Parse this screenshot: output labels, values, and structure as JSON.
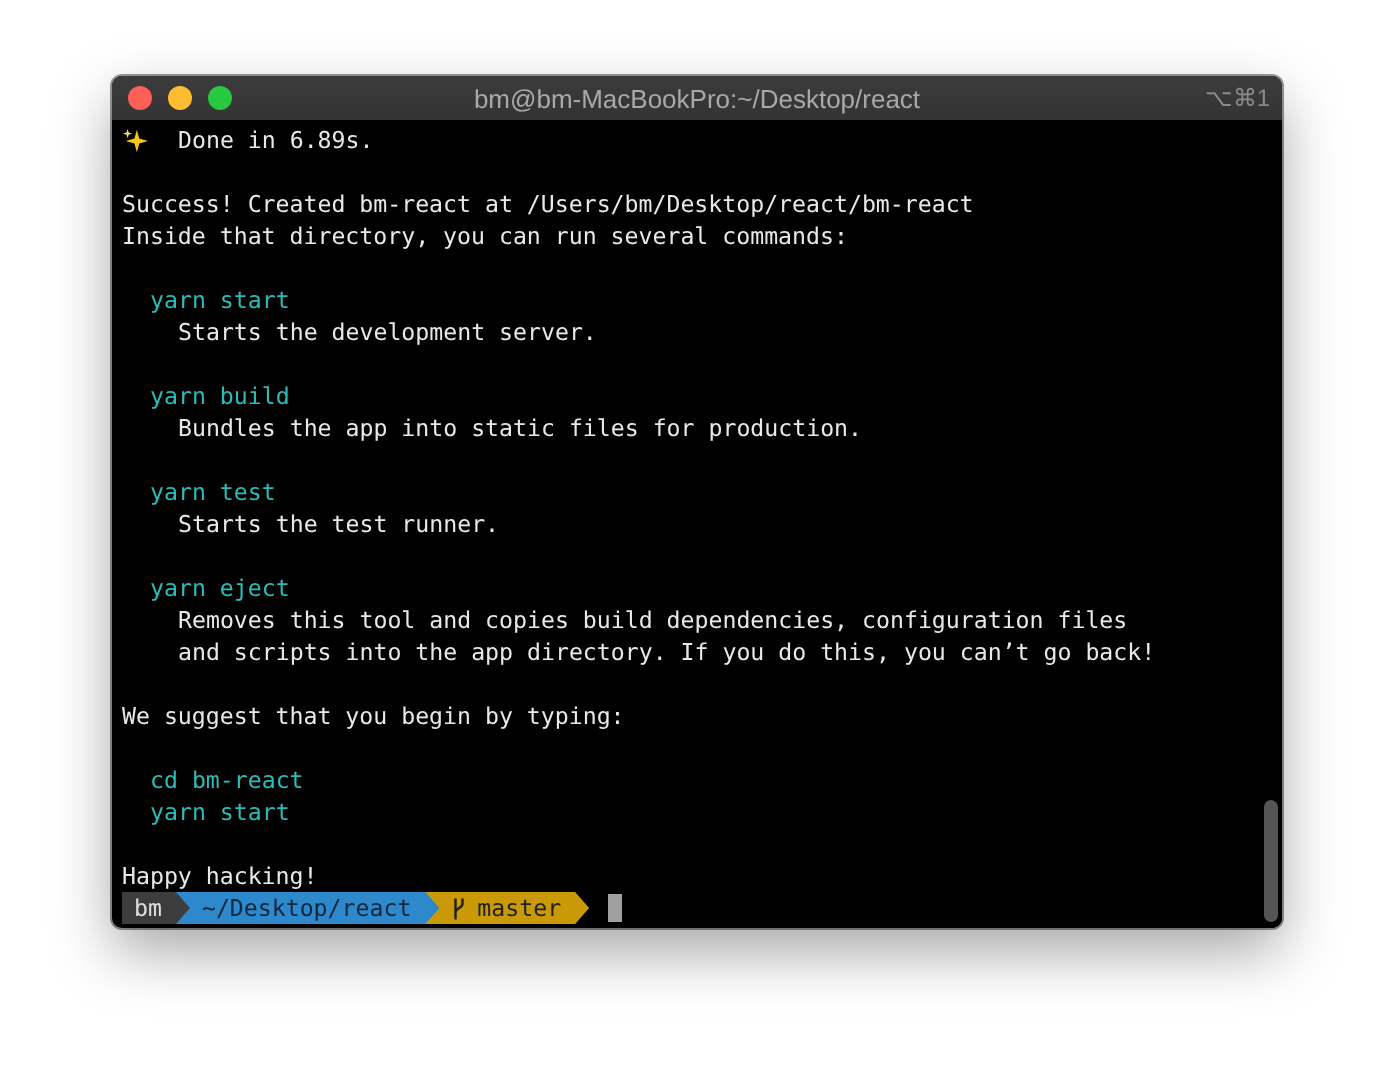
{
  "window": {
    "title": "bm@bm-MacBookPro:~/Desktop/react",
    "shortcut": "⌥⌘1"
  },
  "lines": [
    {
      "kind": "done",
      "text": "Done in 6.89s."
    },
    {
      "kind": "blank"
    },
    {
      "kind": "text",
      "text": "Success! Created bm-react at /Users/bm/Desktop/react/bm-react"
    },
    {
      "kind": "text",
      "text": "Inside that directory, you can run several commands:"
    },
    {
      "kind": "blank"
    },
    {
      "kind": "command",
      "text": "yarn start"
    },
    {
      "kind": "description",
      "text": "Starts the development server."
    },
    {
      "kind": "blank"
    },
    {
      "kind": "command",
      "text": "yarn build"
    },
    {
      "kind": "description",
      "text": "Bundles the app into static files for production."
    },
    {
      "kind": "blank"
    },
    {
      "kind": "command",
      "text": "yarn test"
    },
    {
      "kind": "description",
      "text": "Starts the test runner."
    },
    {
      "kind": "blank"
    },
    {
      "kind": "command",
      "text": "yarn eject"
    },
    {
      "kind": "description",
      "text": "Removes this tool and copies build dependencies, configuration files"
    },
    {
      "kind": "description",
      "text": "and scripts into the app directory. If you do this, you can’t go back!"
    },
    {
      "kind": "blank"
    },
    {
      "kind": "text",
      "text": "We suggest that you begin by typing:"
    },
    {
      "kind": "blank"
    },
    {
      "kind": "command",
      "text": "cd bm-react"
    },
    {
      "kind": "command",
      "text": "yarn start"
    },
    {
      "kind": "blank"
    },
    {
      "kind": "text",
      "text": "Happy hacking!"
    }
  ],
  "prompt": {
    "user": "bm",
    "path": "~/Desktop/react",
    "branch": "master"
  }
}
